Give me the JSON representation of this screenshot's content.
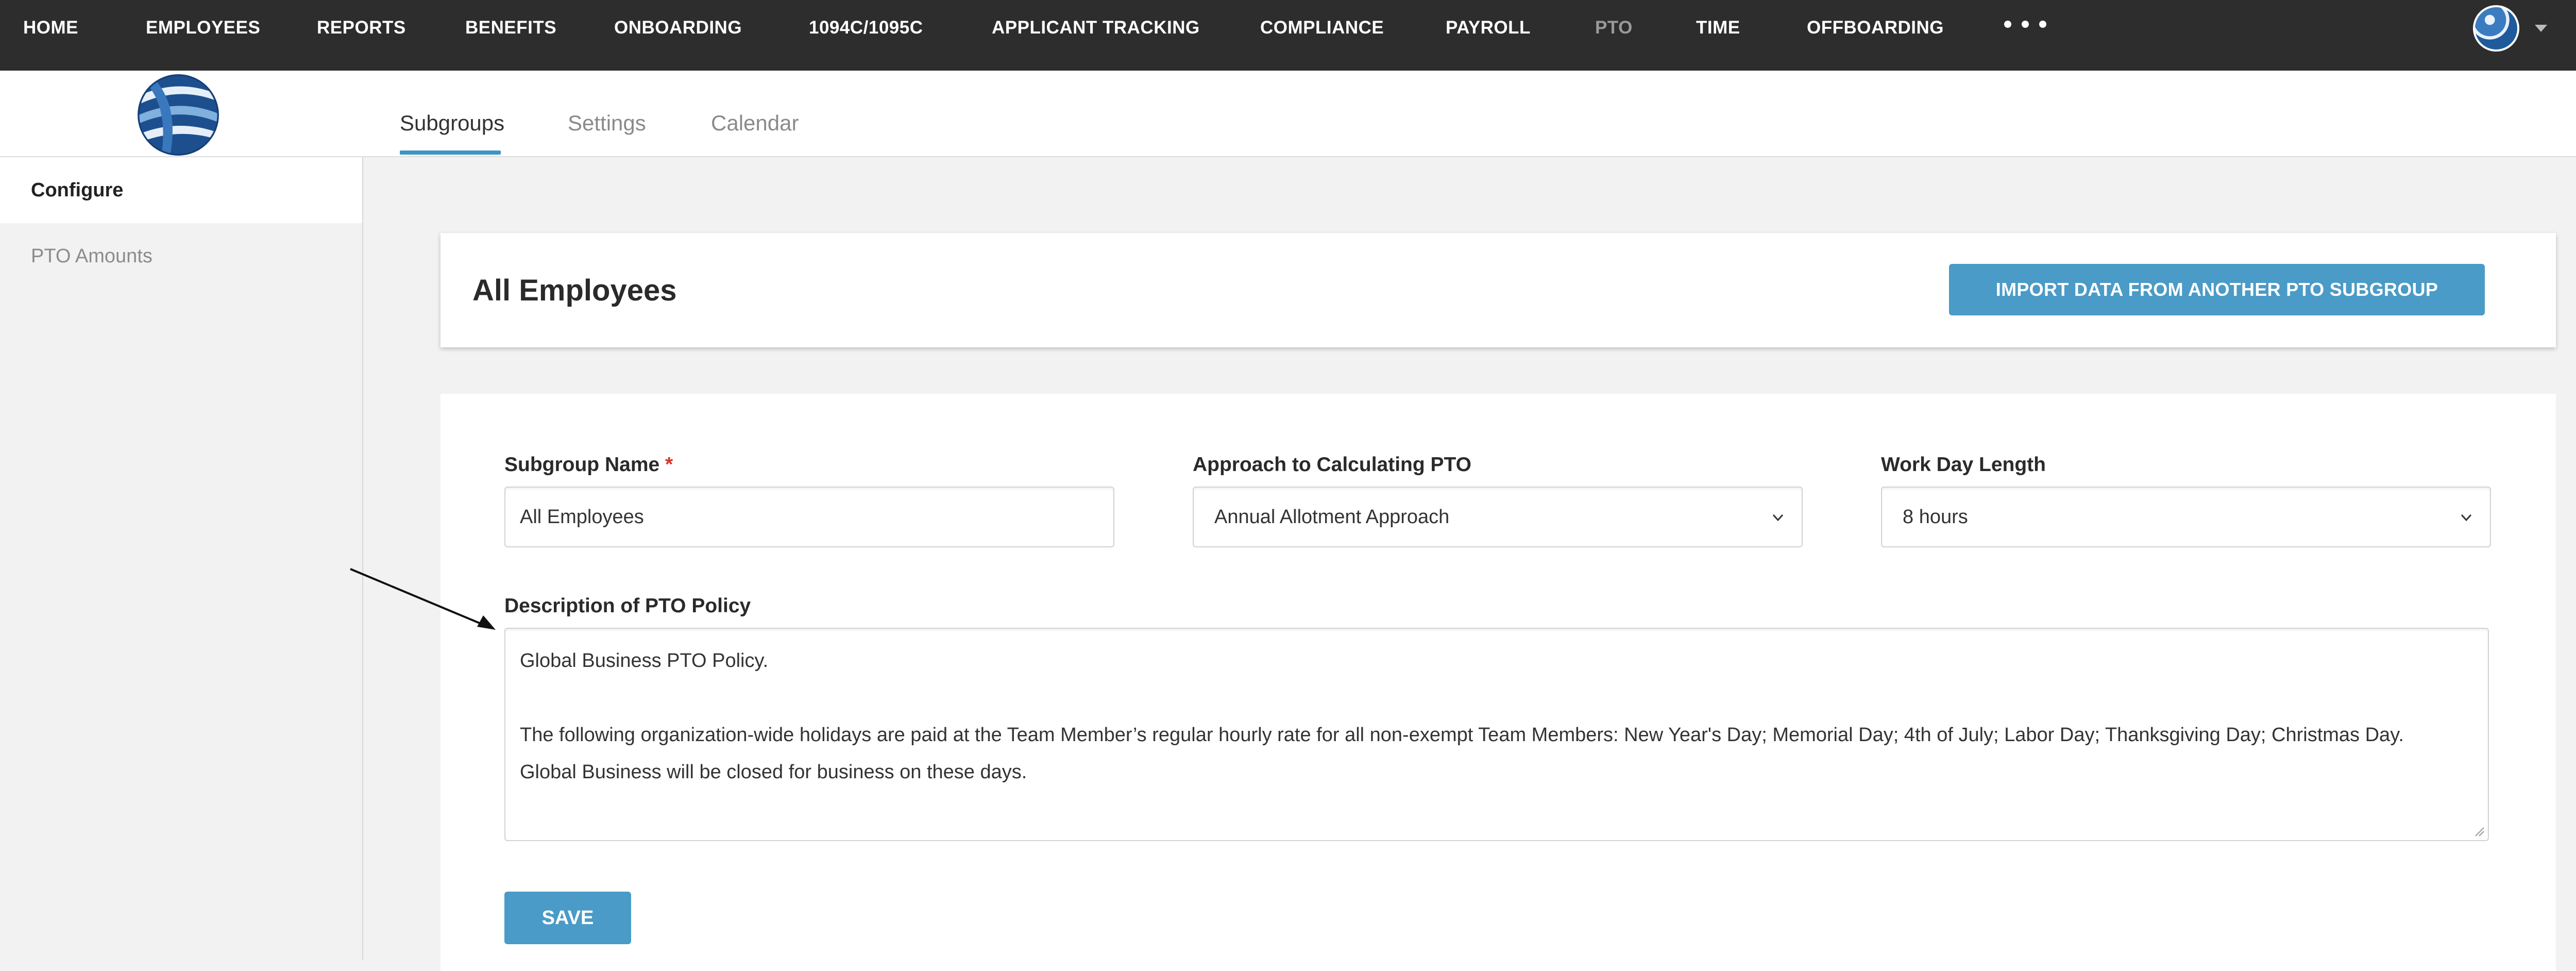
{
  "topnav": {
    "items": [
      "HOME",
      "EMPLOYEES",
      "REPORTS",
      "BENEFITS",
      "ONBOARDING",
      "1094C/1095C",
      "APPLICANT TRACKING",
      "COMPLIANCE",
      "PAYROLL",
      "PTO",
      "TIME",
      "OFFBOARDING"
    ],
    "active": "PTO"
  },
  "subtabs": [
    "Subgroups",
    "Settings",
    "Calendar"
  ],
  "sidebar": {
    "items": [
      "Configure",
      "PTO Amounts"
    ]
  },
  "header": {
    "title": "All Employees",
    "import_button": "IMPORT DATA FROM ANOTHER PTO SUBGROUP"
  },
  "form": {
    "subgroup_name": {
      "label": "Subgroup Name",
      "required_mark": "*",
      "value": "All Employees"
    },
    "approach": {
      "label": "Approach to Calculating PTO",
      "value": "Annual Allotment Approach"
    },
    "work_day": {
      "label": "Work Day Length",
      "value": "8 hours"
    },
    "description": {
      "label": "Description of PTO Policy",
      "line1": "Global Business PTO Policy.",
      "line2": "The following organization-wide holidays are paid at the Team Member’s regular hourly rate for all non-exempt Team Members: New Year's Day; Memorial Day; 4th of July; Labor Day; Thanksgiving Day; Christmas Day.",
      "line3": "Global Business will be closed for business on these days."
    },
    "save_button": "SAVE"
  },
  "colors": {
    "nav_bg": "#2d2d2d",
    "accent": "#4a9bc7",
    "required": "#d9342b"
  }
}
